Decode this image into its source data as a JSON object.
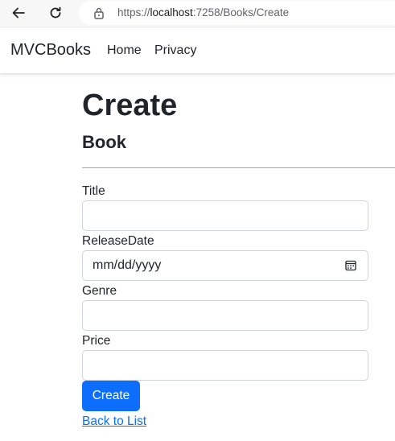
{
  "browser": {
    "url_scheme": "https://",
    "url_host": "localhost",
    "url_rest": ":7258/Books/Create",
    "icons": [
      "back-arrow-icon",
      "reload-icon",
      "lock-icon"
    ]
  },
  "navbar": {
    "brand": "MVCBooks",
    "links": [
      "Home",
      "Privacy"
    ]
  },
  "page": {
    "title": "Create",
    "subtitle": "Book"
  },
  "form": {
    "title_label": "Title",
    "title_value": "",
    "release_label": "ReleaseDate",
    "release_placeholder": "mm/dd/yyyy",
    "genre_label": "Genre",
    "genre_value": "",
    "price_label": "Price",
    "price_value": "",
    "submit_label": "Create",
    "back_link": "Back to List"
  },
  "colors": {
    "primary": "#0d6efd",
    "text": "#212529",
    "border": "#ced4da"
  }
}
